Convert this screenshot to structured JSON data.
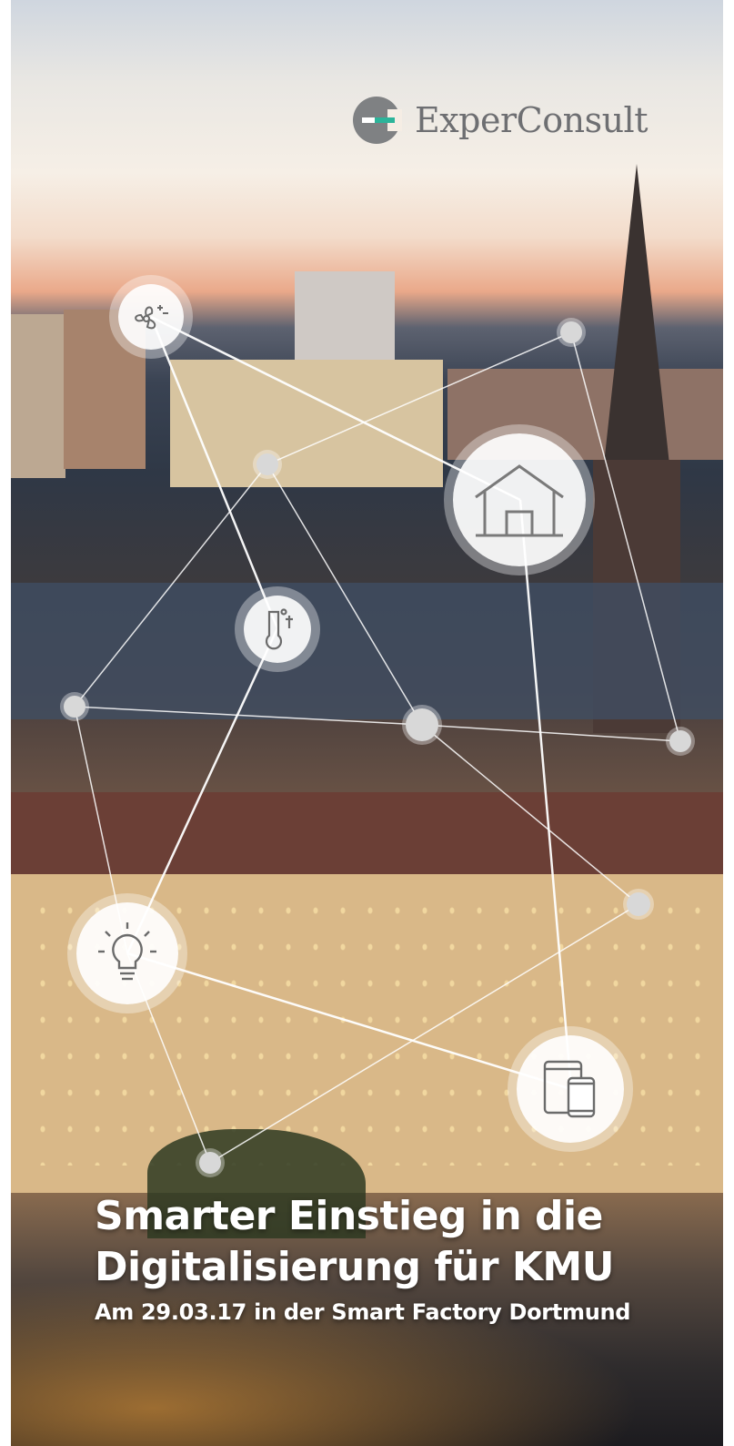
{
  "brand": {
    "name": "ExperConsult",
    "mark_color": "#7f8183",
    "accent_color": "#2db49a"
  },
  "headline": {
    "line1": "Smarter Einstieg in die",
    "line2": "Digitalisierung für KMU",
    "subtitle": "Am 29.03.17 in der Smart Factory Dortmund"
  },
  "icons": [
    "fan-icon",
    "house-icon",
    "thermometer-icon",
    "lightbulb-icon",
    "devices-icon"
  ]
}
